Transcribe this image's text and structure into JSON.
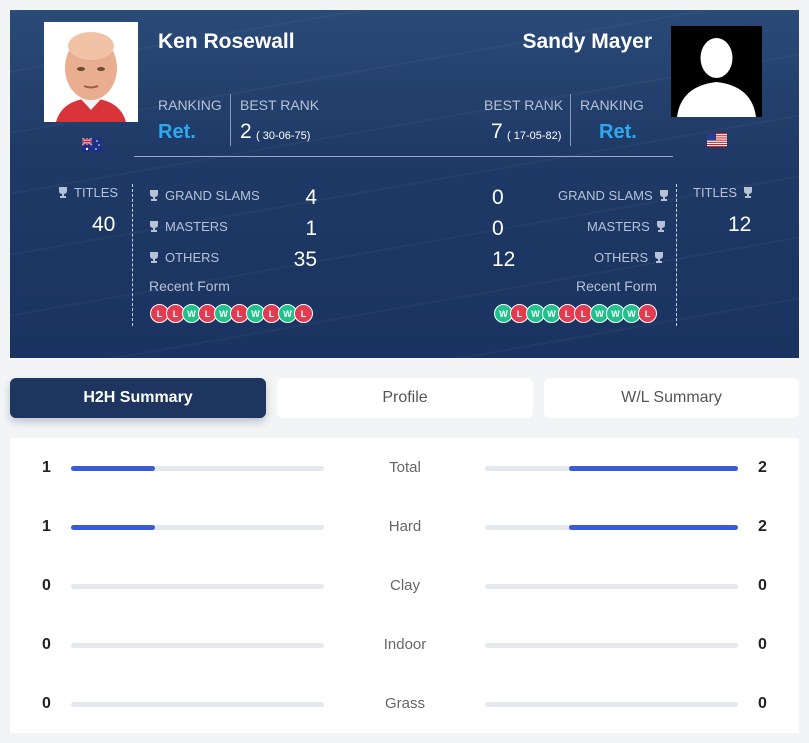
{
  "left_player": {
    "name": "Ken Rosewall",
    "ranking_label": "RANKING",
    "ranking_value": "Ret.",
    "best_rank_label": "BEST RANK",
    "best_rank_value": "2",
    "best_rank_date": "( 30-06-75)",
    "flag": "australia-flag",
    "titles_label": "TITLES",
    "titles_value": "40",
    "grand_slams_label": "GRAND SLAMS",
    "grand_slams_value": "4",
    "masters_label": "MASTERS",
    "masters_value": "1",
    "others_label": "OTHERS",
    "others_value": "35",
    "recent_form_label": "Recent Form",
    "recent_form": [
      "L",
      "L",
      "W",
      "L",
      "W",
      "L",
      "W",
      "L",
      "W",
      "L"
    ]
  },
  "right_player": {
    "name": "Sandy Mayer",
    "ranking_label": "RANKING",
    "ranking_value": "Ret.",
    "best_rank_label": "BEST RANK",
    "best_rank_value": "7",
    "best_rank_date": "( 17-05-82)",
    "flag": "usa-flag",
    "titles_label": "TITLES",
    "titles_value": "12",
    "grand_slams_label": "GRAND SLAMS",
    "grand_slams_value": "0",
    "masters_label": "MASTERS",
    "masters_value": "0",
    "others_label": "OTHERS",
    "others_value": "12",
    "recent_form_label": "Recent Form",
    "recent_form": [
      "W",
      "L",
      "W",
      "W",
      "L",
      "L",
      "W",
      "W",
      "W",
      "L"
    ]
  },
  "tabs": [
    {
      "label": "H2H Summary",
      "active": true
    },
    {
      "label": "Profile",
      "active": false
    },
    {
      "label": "W/L Summary",
      "active": false
    }
  ],
  "h2h": [
    {
      "label": "Total",
      "left": "1",
      "right": "2",
      "left_frac": 0.333,
      "right_frac": 0.667
    },
    {
      "label": "Hard",
      "left": "1",
      "right": "2",
      "left_frac": 0.333,
      "right_frac": 0.667
    },
    {
      "label": "Clay",
      "left": "0",
      "right": "0",
      "left_frac": 0,
      "right_frac": 0
    },
    {
      "label": "Indoor",
      "left": "0",
      "right": "0",
      "left_frac": 0,
      "right_frac": 0
    },
    {
      "label": "Grass",
      "left": "0",
      "right": "0",
      "left_frac": 0,
      "right_frac": 0
    }
  ],
  "colors": {
    "hero_bg": "#1f3a66",
    "ret_accent": "#2fa8f0",
    "win": "#22c08a",
    "loss": "#e23c52",
    "bar_fill": "#3a5bd9",
    "tab_active": "#1e3560"
  }
}
